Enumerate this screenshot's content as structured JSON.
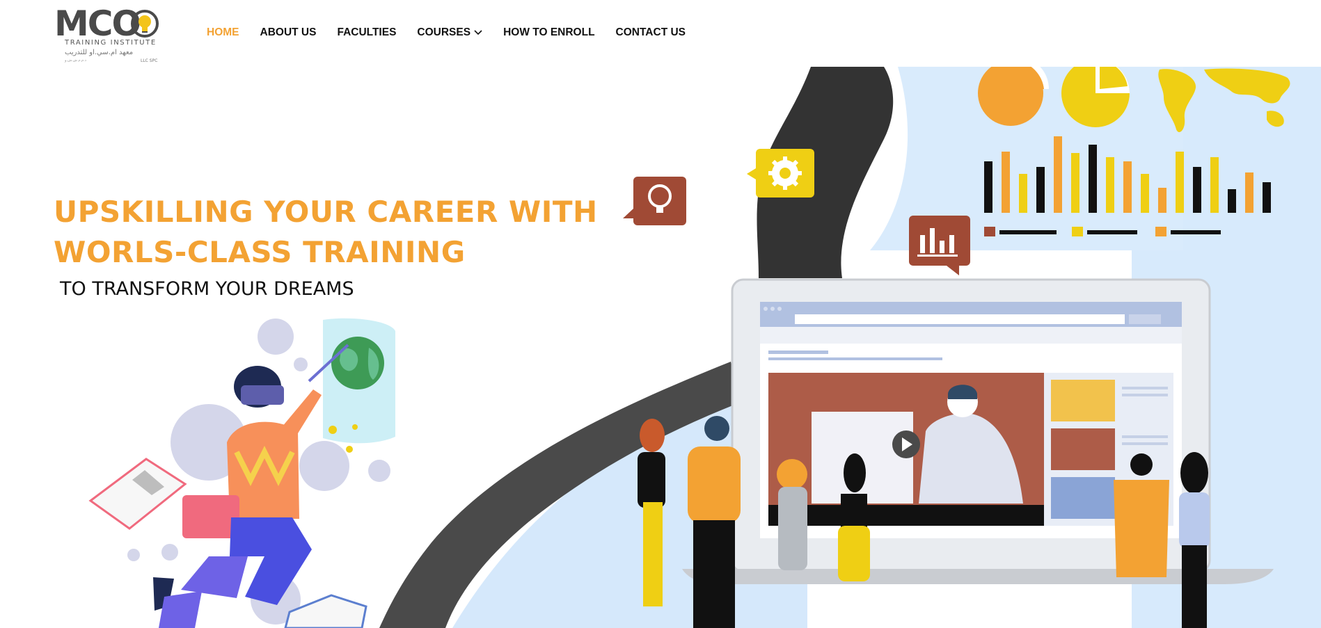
{
  "logo": {
    "brand": "MCO",
    "subtitle": "TRAINING INSTITUTE",
    "arabic": "معهد ام.سي.او للتدريب",
    "tagline": "ذ.م.م ش.ش.و",
    "llc": "LLC SPC"
  },
  "nav": {
    "items": [
      {
        "label": "HOME"
      },
      {
        "label": "ABOUT US"
      },
      {
        "label": "FACULTIES"
      },
      {
        "label": "COURSES"
      },
      {
        "label": "HOW TO ENROLL"
      },
      {
        "label": "CONTACT US"
      }
    ]
  },
  "hero": {
    "line1": "UPSKILLING YOUR CAREER WITH",
    "line2": "WORLS-CLASS TRAINING",
    "subtitle": "TO TRANSFORM YOUR DREAMS"
  },
  "colors": {
    "accent": "#f3a233",
    "yellow": "#efcf14",
    "brick": "#a04a35",
    "dark": "#333333",
    "light_blue": "#d7eafc"
  },
  "icons": [
    "lightbulb-icon",
    "gear-icon",
    "bar-chart-icon",
    "play-icon",
    "chevron-down-icon"
  ]
}
